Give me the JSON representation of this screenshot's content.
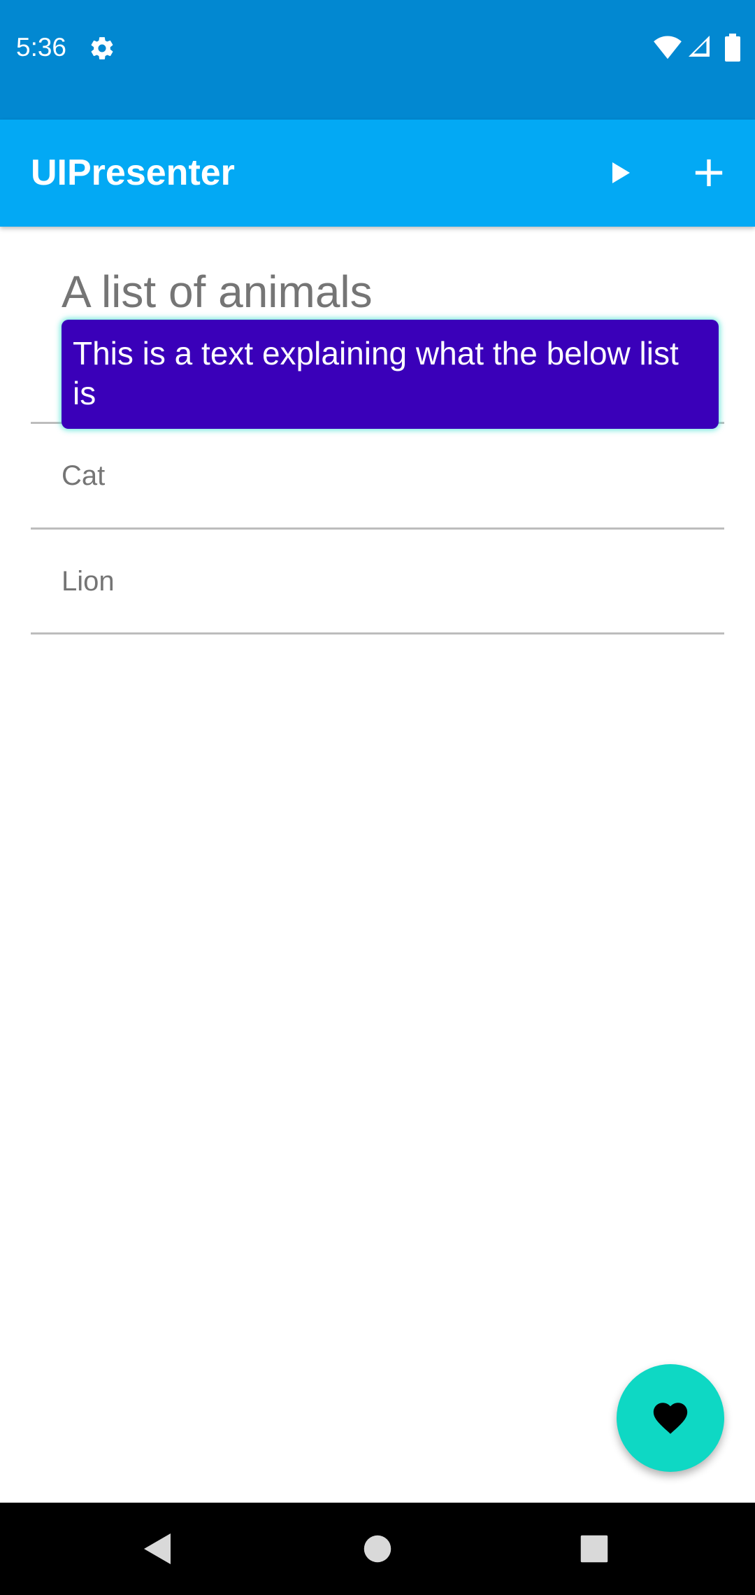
{
  "status_bar": {
    "time": "5:36",
    "icons": [
      "gear-icon",
      "wifi-icon",
      "cell-signal-icon",
      "battery-icon"
    ],
    "background": "#0288d1"
  },
  "app_bar": {
    "title": "UIPresenter",
    "actions": [
      "play-icon",
      "add-icon"
    ],
    "background": "#03a9f4"
  },
  "content": {
    "heading": "A list of animals",
    "items": [
      {
        "label": "Cat"
      },
      {
        "label": "Lion"
      }
    ]
  },
  "tooltip": {
    "text": "This is a text explaining what the below list is",
    "background": "#3a00b9",
    "glow": "#40e0d0"
  },
  "fab": {
    "icon": "heart-icon",
    "background": "#0ed8c4"
  },
  "nav_bar": {
    "buttons": [
      "back-icon",
      "home-icon",
      "recents-icon"
    ]
  }
}
